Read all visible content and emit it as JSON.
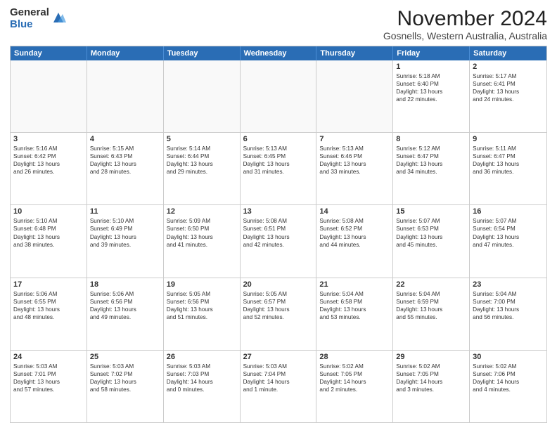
{
  "logo": {
    "general": "General",
    "blue": "Blue"
  },
  "title": "November 2024",
  "subtitle": "Gosnells, Western Australia, Australia",
  "headers": [
    "Sunday",
    "Monday",
    "Tuesday",
    "Wednesday",
    "Thursday",
    "Friday",
    "Saturday"
  ],
  "weeks": [
    [
      {
        "day": "",
        "info": ""
      },
      {
        "day": "",
        "info": ""
      },
      {
        "day": "",
        "info": ""
      },
      {
        "day": "",
        "info": ""
      },
      {
        "day": "",
        "info": ""
      },
      {
        "day": "1",
        "info": "Sunrise: 5:18 AM\nSunset: 6:40 PM\nDaylight: 13 hours\nand 22 minutes."
      },
      {
        "day": "2",
        "info": "Sunrise: 5:17 AM\nSunset: 6:41 PM\nDaylight: 13 hours\nand 24 minutes."
      }
    ],
    [
      {
        "day": "3",
        "info": "Sunrise: 5:16 AM\nSunset: 6:42 PM\nDaylight: 13 hours\nand 26 minutes."
      },
      {
        "day": "4",
        "info": "Sunrise: 5:15 AM\nSunset: 6:43 PM\nDaylight: 13 hours\nand 28 minutes."
      },
      {
        "day": "5",
        "info": "Sunrise: 5:14 AM\nSunset: 6:44 PM\nDaylight: 13 hours\nand 29 minutes."
      },
      {
        "day": "6",
        "info": "Sunrise: 5:13 AM\nSunset: 6:45 PM\nDaylight: 13 hours\nand 31 minutes."
      },
      {
        "day": "7",
        "info": "Sunrise: 5:13 AM\nSunset: 6:46 PM\nDaylight: 13 hours\nand 33 minutes."
      },
      {
        "day": "8",
        "info": "Sunrise: 5:12 AM\nSunset: 6:47 PM\nDaylight: 13 hours\nand 34 minutes."
      },
      {
        "day": "9",
        "info": "Sunrise: 5:11 AM\nSunset: 6:47 PM\nDaylight: 13 hours\nand 36 minutes."
      }
    ],
    [
      {
        "day": "10",
        "info": "Sunrise: 5:10 AM\nSunset: 6:48 PM\nDaylight: 13 hours\nand 38 minutes."
      },
      {
        "day": "11",
        "info": "Sunrise: 5:10 AM\nSunset: 6:49 PM\nDaylight: 13 hours\nand 39 minutes."
      },
      {
        "day": "12",
        "info": "Sunrise: 5:09 AM\nSunset: 6:50 PM\nDaylight: 13 hours\nand 41 minutes."
      },
      {
        "day": "13",
        "info": "Sunrise: 5:08 AM\nSunset: 6:51 PM\nDaylight: 13 hours\nand 42 minutes."
      },
      {
        "day": "14",
        "info": "Sunrise: 5:08 AM\nSunset: 6:52 PM\nDaylight: 13 hours\nand 44 minutes."
      },
      {
        "day": "15",
        "info": "Sunrise: 5:07 AM\nSunset: 6:53 PM\nDaylight: 13 hours\nand 45 minutes."
      },
      {
        "day": "16",
        "info": "Sunrise: 5:07 AM\nSunset: 6:54 PM\nDaylight: 13 hours\nand 47 minutes."
      }
    ],
    [
      {
        "day": "17",
        "info": "Sunrise: 5:06 AM\nSunset: 6:55 PM\nDaylight: 13 hours\nand 48 minutes."
      },
      {
        "day": "18",
        "info": "Sunrise: 5:06 AM\nSunset: 6:56 PM\nDaylight: 13 hours\nand 49 minutes."
      },
      {
        "day": "19",
        "info": "Sunrise: 5:05 AM\nSunset: 6:56 PM\nDaylight: 13 hours\nand 51 minutes."
      },
      {
        "day": "20",
        "info": "Sunrise: 5:05 AM\nSunset: 6:57 PM\nDaylight: 13 hours\nand 52 minutes."
      },
      {
        "day": "21",
        "info": "Sunrise: 5:04 AM\nSunset: 6:58 PM\nDaylight: 13 hours\nand 53 minutes."
      },
      {
        "day": "22",
        "info": "Sunrise: 5:04 AM\nSunset: 6:59 PM\nDaylight: 13 hours\nand 55 minutes."
      },
      {
        "day": "23",
        "info": "Sunrise: 5:04 AM\nSunset: 7:00 PM\nDaylight: 13 hours\nand 56 minutes."
      }
    ],
    [
      {
        "day": "24",
        "info": "Sunrise: 5:03 AM\nSunset: 7:01 PM\nDaylight: 13 hours\nand 57 minutes."
      },
      {
        "day": "25",
        "info": "Sunrise: 5:03 AM\nSunset: 7:02 PM\nDaylight: 13 hours\nand 58 minutes."
      },
      {
        "day": "26",
        "info": "Sunrise: 5:03 AM\nSunset: 7:03 PM\nDaylight: 14 hours\nand 0 minutes."
      },
      {
        "day": "27",
        "info": "Sunrise: 5:03 AM\nSunset: 7:04 PM\nDaylight: 14 hours\nand 1 minute."
      },
      {
        "day": "28",
        "info": "Sunrise: 5:02 AM\nSunset: 7:05 PM\nDaylight: 14 hours\nand 2 minutes."
      },
      {
        "day": "29",
        "info": "Sunrise: 5:02 AM\nSunset: 7:05 PM\nDaylight: 14 hours\nand 3 minutes."
      },
      {
        "day": "30",
        "info": "Sunrise: 5:02 AM\nSunset: 7:06 PM\nDaylight: 14 hours\nand 4 minutes."
      }
    ]
  ]
}
